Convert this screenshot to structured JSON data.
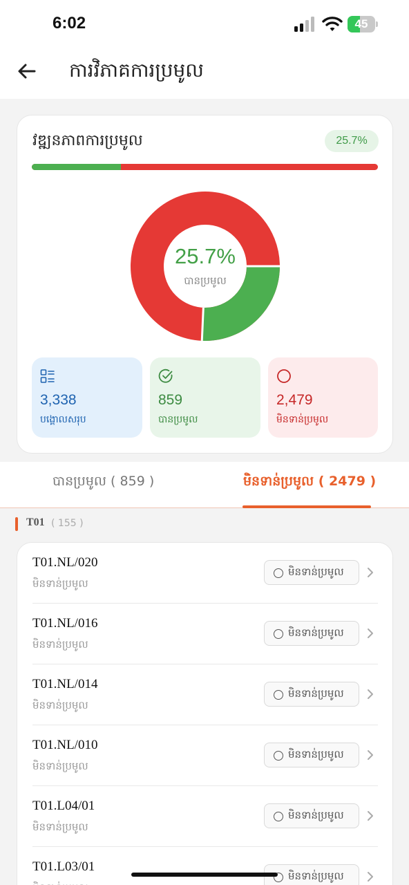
{
  "status_bar": {
    "time": "6:02",
    "battery": "45",
    "battery_level": 0.45
  },
  "header": {
    "title": "ការវិភាគការប្រមូល"
  },
  "summary": {
    "title": "វឌ្ឍនភាពការប្រមូល",
    "percent_label": "25.7%",
    "collected_fraction": 0.257,
    "center_percent": "25.7%",
    "center_label": "បានប្រមូល",
    "colors": {
      "collected": "#4caf50",
      "pending": "#e53935"
    },
    "stats": [
      {
        "icon": "list-icon",
        "value": "3,338",
        "label": "បង្គោលសរុប"
      },
      {
        "icon": "check-circle-icon",
        "value": "859",
        "label": "បានប្រមូល"
      },
      {
        "icon": "circle-icon",
        "value": "2,479",
        "label": "មិនទាន់ប្រមូល"
      }
    ]
  },
  "tabs": [
    {
      "label": "បានប្រមូល ( 859 )",
      "active": false
    },
    {
      "label": "មិនទាន់ប្រមូល ( 2479 )",
      "active": true
    }
  ],
  "group": {
    "name": "T01",
    "count": "( 155 )"
  },
  "items": [
    {
      "code": "T01.NL/020",
      "status": "មិនទាន់ប្រមូល",
      "badge": "មិនទាន់ប្រមូល"
    },
    {
      "code": "T01.NL/016",
      "status": "មិនទាន់ប្រមូល",
      "badge": "មិនទាន់ប្រមូល"
    },
    {
      "code": "T01.NL/014",
      "status": "មិនទាន់ប្រមូល",
      "badge": "មិនទាន់ប្រមូល"
    },
    {
      "code": "T01.NL/010",
      "status": "មិនទាន់ប្រមូល",
      "badge": "មិនទាន់ប្រមូល"
    },
    {
      "code": "T01.L04/01",
      "status": "មិនទាន់ប្រមូល",
      "badge": "មិនទាន់ប្រមូល"
    },
    {
      "code": "T01.L03/01",
      "status": "មិនទាន់ប្រមូល",
      "badge": "មិនទាន់ប្រមូល"
    }
  ]
}
